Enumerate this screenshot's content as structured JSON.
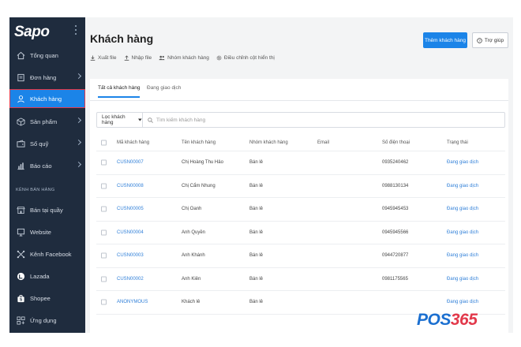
{
  "sidebar": {
    "logo": "Sapo",
    "items": [
      {
        "label": "Tổng quan",
        "icon": "home-icon",
        "chev": false
      },
      {
        "label": "Đơn hàng",
        "icon": "order-icon",
        "chev": true
      },
      {
        "label": "Khách hàng",
        "icon": "user-icon",
        "chev": false,
        "active": true
      },
      {
        "label": "Sản phẩm",
        "icon": "box-icon",
        "chev": true
      },
      {
        "label": "Sổ quỹ",
        "icon": "wallet-icon",
        "chev": true
      },
      {
        "label": "Báo cáo",
        "icon": "chart-icon",
        "chev": true
      }
    ],
    "section_label": "KÊNH BÁN HÀNG",
    "channels": [
      {
        "label": "Bán tại quầy",
        "icon": "store-icon"
      },
      {
        "label": "Website",
        "icon": "monitor-icon"
      },
      {
        "label": "Kênh Facebook",
        "icon": "share-icon"
      },
      {
        "label": "Lazada",
        "icon": "lazada-icon"
      },
      {
        "label": "Shopee",
        "icon": "shopee-icon"
      },
      {
        "label": "Ứng dụng",
        "icon": "apps-icon"
      }
    ]
  },
  "header": {
    "title": "Khách hàng",
    "toolbar": {
      "export": "Xuất file",
      "import": "Nhập file",
      "groups": "Nhóm khách hàng",
      "columns": "Điều chỉnh cột hiển thị"
    },
    "add_button": "Thêm khách hàng",
    "help_button": "Trợ giúp"
  },
  "tabs": [
    "Tất cả khách hàng",
    "Đang giao dịch"
  ],
  "filter": {
    "select_label": "Lọc khách hàng",
    "search_placeholder": "Tìm kiếm khách hàng"
  },
  "table": {
    "columns": [
      "Mã khách hàng",
      "Tên khách hàng",
      "Nhóm khách hàng",
      "Email",
      "Số điện thoại",
      "Trạng thái"
    ],
    "rows": [
      [
        "CUSN00007",
        "Chị Hoàng Thu Hảo",
        "Bán lẻ",
        "",
        "0935240462",
        "Đang giao dịch"
      ],
      [
        "CUSN00008",
        "Chị Cẩm Nhung",
        "Bán lẻ",
        "",
        "0988130134",
        "Đang giao dịch"
      ],
      [
        "CUSN00005",
        "Chị Oanh",
        "Bán lẻ",
        "",
        "0945945453",
        "Đang giao dịch"
      ],
      [
        "CUSN00004",
        "Anh Quyền",
        "Bán lẻ",
        "",
        "0945945566",
        "Đang giao dịch"
      ],
      [
        "CUSN00003",
        "Anh Khánh",
        "Bán lẻ",
        "",
        "0944720877",
        "Đang giao dịch"
      ],
      [
        "CUSN00002",
        "Anh Kiên",
        "Bán lẻ",
        "",
        "0981175565",
        "Đang giao dịch"
      ],
      [
        "ANONYMOUS",
        "Khách lẻ",
        "Bán lẻ",
        "",
        "",
        "Đang giao dịch"
      ]
    ]
  },
  "watermark": {
    "part1": "POS",
    "part2": "365"
  },
  "colors": {
    "sidebar_bg": "#1f2c3e",
    "accent": "#1b84e8",
    "link": "#2f7fd8",
    "active_border": "#e2394b"
  }
}
